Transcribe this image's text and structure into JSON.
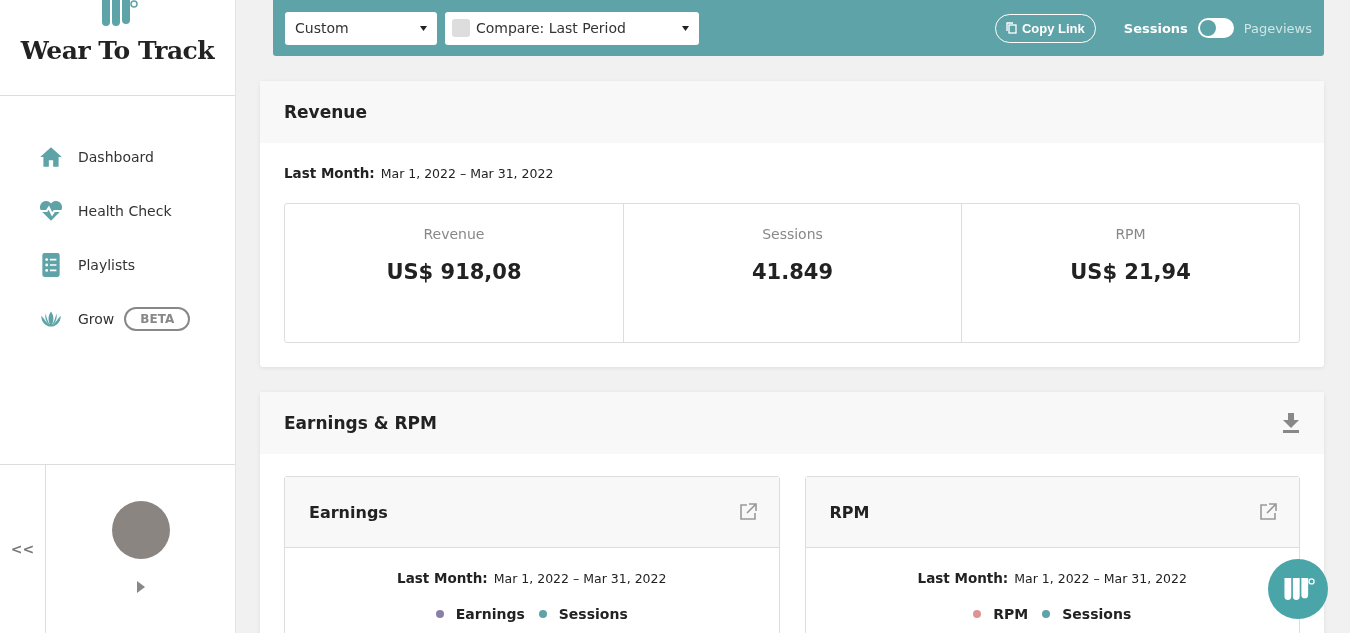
{
  "brand": {
    "name": "Wear To Track"
  },
  "nav": [
    {
      "label": "Dashboard"
    },
    {
      "label": "Health Check"
    },
    {
      "label": "Playlists"
    },
    {
      "label": "Grow",
      "badge": "BETA"
    }
  ],
  "collapse": "<<",
  "toolbar": {
    "range": "Custom",
    "compare": {
      "label": "Compare: Last Period",
      "checked": false
    },
    "copy_link": "Copy Link",
    "metric_toggle": [
      {
        "label": "Sessions",
        "selected": true
      },
      {
        "label": "Pageviews",
        "selected": false
      }
    ]
  },
  "revenue": {
    "title": "Revenue",
    "period_label": "Last Month:",
    "period": "Mar 1, 2022 – Mar 31, 2022",
    "stats": [
      {
        "label": "Revenue",
        "value": "US$ 918,08"
      },
      {
        "label": "Sessions",
        "value": "41.849"
      },
      {
        "label": "RPM",
        "value": "US$ 21,94"
      }
    ]
  },
  "earnings_rpm": {
    "title": "Earnings & RPM",
    "cards": [
      {
        "title": "Earnings",
        "period_label": "Last Month:",
        "period": "Mar 1, 2022 – Mar 31, 2022",
        "legend": [
          {
            "label": "Earnings",
            "color": "#8a7fa8"
          },
          {
            "label": "Sessions",
            "color": "#5ea3a8"
          }
        ]
      },
      {
        "title": "RPM",
        "period_label": "Last Month:",
        "period": "Mar 1, 2022 – Mar 31, 2022",
        "legend": [
          {
            "label": "RPM",
            "color": "#de9494"
          },
          {
            "label": "Sessions",
            "color": "#5ea3a8"
          }
        ]
      }
    ]
  }
}
